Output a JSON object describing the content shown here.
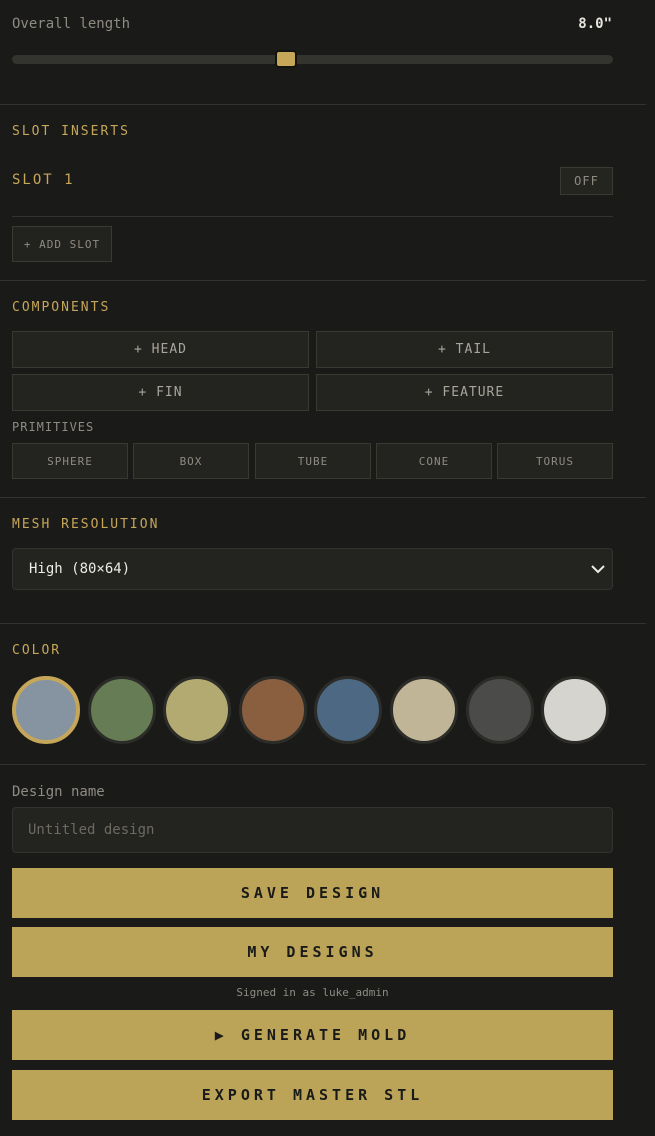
{
  "length": {
    "label": "Overall length",
    "value_text": "8.0\"",
    "fraction": 0.456
  },
  "slot_inserts": {
    "title": "SLOT INSERTS",
    "slots": [
      {
        "name": "SLOT 1",
        "toggle": "OFF"
      }
    ],
    "add_label": "+ ADD SLOT"
  },
  "components": {
    "title": "COMPONENTS",
    "buttons": [
      "+ HEAD",
      "+ TAIL",
      "+ FIN",
      "+ FEATURE"
    ],
    "primitives_label": "PRIMITIVES",
    "primitives": [
      "SPHERE",
      "BOX",
      "TUBE",
      "CONE",
      "TORUS"
    ]
  },
  "mesh": {
    "title": "MESH RESOLUTION",
    "selected": "High (80×64)"
  },
  "color": {
    "title": "COLOR",
    "swatches": [
      "#8694a2",
      "#667c55",
      "#b3aa72",
      "#8a5f40",
      "#4c6883",
      "#c1b598",
      "#4b4b49",
      "#d6d4cf"
    ],
    "selected_index": 0
  },
  "design": {
    "name_label": "Design name",
    "placeholder": "Untitled design"
  },
  "actions": {
    "save": "SAVE DESIGN",
    "my_designs": "MY DESIGNS",
    "signed_in": "Signed in as luke_admin",
    "generate": "▶ GENERATE MOLD",
    "export": "EXPORT MASTER STL"
  },
  "accent": "#c6a75a"
}
